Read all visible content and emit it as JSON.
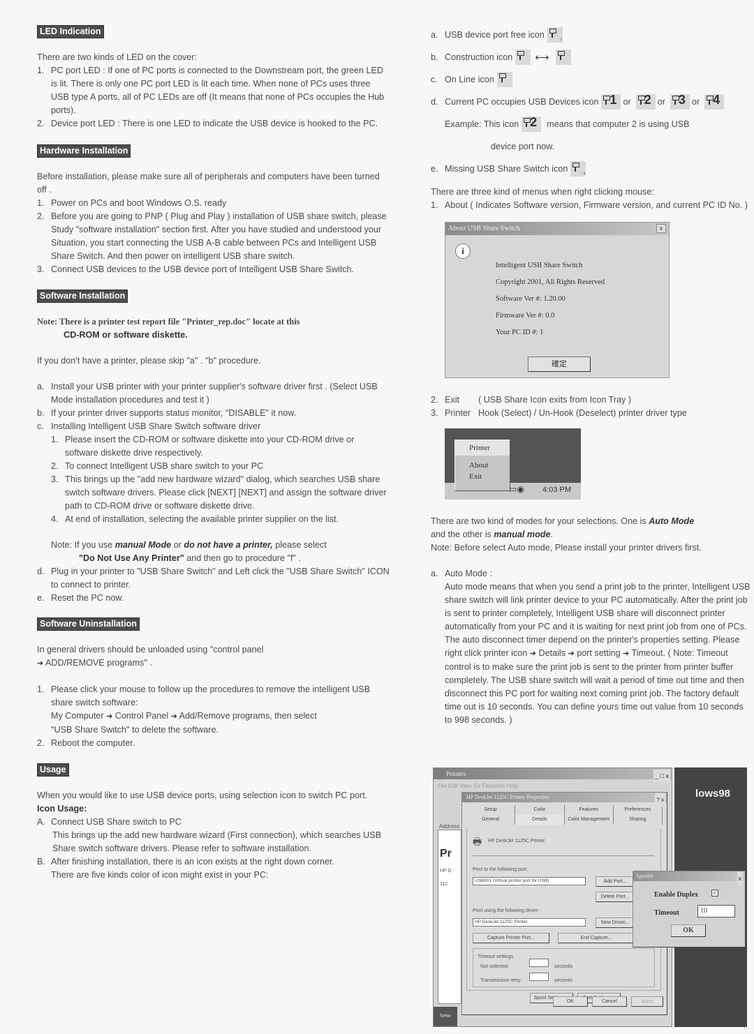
{
  "left": {
    "led": {
      "heading": "LED Indication",
      "intro": "There are two kinds of LED on the cover:",
      "items": [
        {
          "num": "1.",
          "text": "PC port LED : If one of PC ports is connected to the Downstream port, the green LED is lit. There is only one PC port LED is lit each time. When none of PCs uses three USB type A ports, all of PC LEDs are off (It means that none of PCs occupies the Hub ports)."
        },
        {
          "num": "2.",
          "text": "Device port LED : There is one LED to indicate the USB device is hooked to the PC."
        }
      ]
    },
    "hardware": {
      "heading": "Hardware Installation",
      "intro": "Before installation, please make sure all of peripherals and computers have been turned off .",
      "items": [
        {
          "num": "1.",
          "text": "Power on PCs and boot Windows O.S. ready"
        },
        {
          "num": "2.",
          "text": "Before you are going to PNP ( Plug and Play ) installation of USB share switch, please Study \"software installation\" section first. After you have studied and understood your Situation, you start connecting the USB A-B cable between PCs and Intelligent USB Share Switch. And then power on intelligent USB share switch."
        },
        {
          "num": "3.",
          "text": "Connect USB devices to the USB device port of Intelligent USB Share Switch."
        }
      ]
    },
    "software": {
      "heading": "Software Installation",
      "note_line1": "Note: There is a printer test report file \"Printer_rep.doc\" locate at this",
      "note_line2": "CD-ROM or software diskette.",
      "skip": "If you don't have a printer, please skip \"a\" . \"b\" procedure.",
      "a_num": "a.",
      "a_text": "Install your USB printer with your printer supplier's software driver first . (Select USB Mode installation procedures and test it )",
      "b_num": "b.",
      "b_text": "If your printer driver supports status monitor, \"DISABLE\" it now.",
      "c_num": "c.",
      "c_text": "Installing Intelligent USB Share Switch software driver",
      "c_items": [
        {
          "num": "1.",
          "text": "Please insert the CD-ROM or software diskette into your CD-ROM drive or software diskette drive respectively."
        },
        {
          "num": "2.",
          "text": "To connect Intelligent USB share switch to your PC"
        },
        {
          "num": "3.",
          "text": "This brings up the \"add new hardware wizard\" dialog, which searches USB share switch software drivers. Please click [NEXT] [NEXT] and assign the software driver path to CD-ROM drive or software diskette drive."
        },
        {
          "num": "4.",
          "text": "At end of installation, selecting the available printer supplier on the list."
        }
      ],
      "note2_prefix": "Note: If you use ",
      "note2_manual": "manual Mode",
      "note2_or": " or ",
      "note2_noprinter": "do not have a printer,",
      "note2_please": " please select",
      "note2_option": "\"Do Not Use Any Printer\"",
      "note2_then": " and then go to procedure \"f\" .",
      "d_num": "d.",
      "d_text": "Plug in your printer to \"USB Share Switch\" and Left click the \"USB Share Switch\" ICON to connect to printer.",
      "e_num": "e.",
      "e_text": "Reset the PC now."
    },
    "uninstall": {
      "heading": "Software Uninstallation",
      "intro1": "In general drivers should be unloaded using \"control panel",
      "intro2": "ADD/REMOVE programs\" .",
      "item1_num": "1.",
      "item1_text": "Please click your mouse to follow up the procedures to remove the intelligent USB share switch software:",
      "path": [
        "My Computer",
        "Control Panel",
        "Add/Remove programs, then select"
      ],
      "path_tail": "\"USB Share Switch\" to delete the software.",
      "item2_num": "2.",
      "item2_text": "Reboot the computer."
    },
    "usage": {
      "heading": "Usage",
      "intro": "When you would like to use USB device ports, using selection icon to switch PC port.",
      "icon_usage_label": "Icon Usage:",
      "A_num": "A.",
      "A_title": "Connect USB Share switch to PC",
      "A_text": "This brings up the add new hardware wizard (First connection), which searches USB Share switch software drivers. Please refer to software installation.",
      "B_num": "B.",
      "B_text": "After finishing installation, there is an icon exists at the right down corner.",
      "B_text2": "There are five kinds color of icon might exist in your PC:"
    }
  },
  "right": {
    "icons": {
      "a": {
        "num": "a.",
        "text": "USB device port free icon"
      },
      "b": {
        "num": "b.",
        "text": "Construction icon"
      },
      "c": {
        "num": "c.",
        "text": "On Line icon"
      },
      "d": {
        "num": "d.",
        "text": "Current PC occupies USB Devices icon",
        "or": "or",
        "numbers": [
          "1",
          "2",
          "3",
          "4"
        ]
      },
      "example_prefix": "Example: This icon",
      "example_number": "2",
      "example_suffix": "means that computer 2 is using USB",
      "example_tail": "device port now.",
      "e": {
        "num": "e.",
        "text": "Missing USB Share Switch icon"
      }
    },
    "menus_intro": "There are three kind of menus when right clicking mouse:",
    "menu_about_num": "1.",
    "menu_about": "About    ( Indicates Software version, Firmware version, and current PC ID No. )",
    "about_dialog": {
      "title": "About USB Share Switch",
      "close": "x",
      "lines": [
        "Intelligent USB Share Switch",
        "Copyright 2001, All Rights Reserved",
        "Software Ver #:  1.20.00",
        "Firmware Ver #:  0.0",
        "Your PC ID #:    1"
      ],
      "ok": "確定"
    },
    "menu_exit_num": "2.",
    "menu_exit": "Exit",
    "menu_exit_desc": "( USB Share Icon exits from Icon Tray )",
    "menu_printer_num": "3.",
    "menu_printer": "Printer",
    "menu_printer_desc": "Hook (Select) / Un-Hook (Deselect) printer driver type",
    "tray_menu": {
      "items": [
        "Printer",
        "About",
        "Exit"
      ],
      "time": "4:03 PM"
    },
    "modes_intro1": "There are two kind of modes for your selections. One is ",
    "modes_auto": "Auto Mode",
    "modes_intro2": "and the other is ",
    "modes_manual": "manual mode",
    "modes_intro3": ".",
    "modes_note": "Note: Before select Auto mode, Please install your printer drivers first.",
    "auto_num": "a.",
    "auto_title": "Auto Mode :",
    "auto_text1": "Auto mode means that when you send a print job to the printer, Intelligent USB share switch will link printer device to your PC automatically. After the print job is sent to printer completely, Intelligent USB share will disconnect printer automatically from your PC and it is waiting for next print job from one of PCs.",
    "auto_text2_a": "The auto disconnect timer depend on the printer's properties setting. Please right click printer icon",
    "auto_path": [
      "Details",
      "port setting",
      "Timeout."
    ],
    "auto_text2_b": "( Note: Timeout control is to make sure the print job is sent to the printer from printer buffer completely. The USB share switch will wait a period of time out time and then disconnect this PC port for waiting next coming print job. The factory default time out is 10 seconds. You can define yours time out value from 10 seconds to 998 seconds. )",
    "printer_window": {
      "title": "Printers",
      "controls": "_ □ x",
      "menubar": "File  Edit  View  Go  Favorites  Help",
      "address": "Address",
      "side_big": "Pr",
      "side_text": "HP D 112",
      "taskbar": "Netw",
      "win98": "lows98"
    },
    "properties": {
      "title": "HP DeskJet 1125C Printer Properties",
      "help": "? x",
      "tabs_row1": [
        "Setup",
        "Color",
        "Features",
        "Preferences"
      ],
      "tabs_row2": [
        "General",
        "Details",
        "Color Management",
        "Sharing"
      ],
      "printer_name": "HP DeskJet 1125C Printer",
      "port_label": "Print to the following port:",
      "port_value": "USB001  (Virtual printer port for USB)",
      "add_port": "Add Port...",
      "delete_port": "Delete Port...",
      "driver_label": "Print using the following driver:",
      "driver_value": "HP DeskJet 1125C Printer",
      "new_driver": "New Driver...",
      "capture": "Capture Printer Port...",
      "end_capture": "End Capture...",
      "timeout_label": "Timeout settings",
      "not_selected": "Not selected:",
      "transmission": "Transmission retry:",
      "seconds": "seconds",
      "spool": "Spool Settings...",
      "port_settings": "Port Settings...",
      "ok": "OK",
      "cancel": "Cancel",
      "apply": "Apply"
    },
    "spooler": {
      "title": "Spooler",
      "close": "x",
      "duplex_label": "Enable Duplex",
      "duplex_checked": "✓",
      "timeout_label": "Timeout",
      "timeout_value": "10",
      "ok": "OK"
    }
  }
}
